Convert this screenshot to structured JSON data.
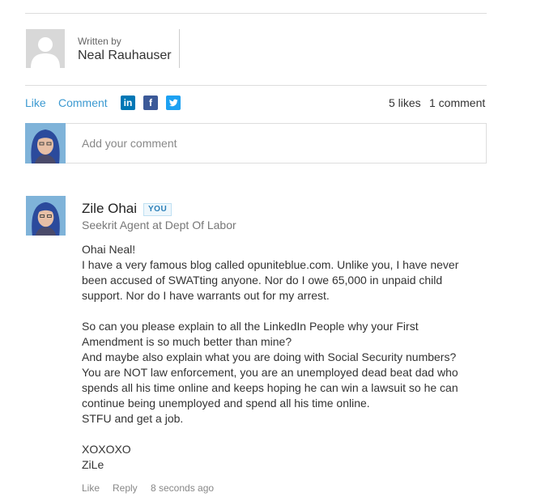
{
  "article": {
    "written_by_label": "Written by",
    "author_name": "Neal Rauhauser"
  },
  "actions": {
    "like_label": "Like",
    "comment_label": "Comment",
    "share": [
      {
        "name": "linkedin-share-icon",
        "glyph": "in",
        "color": "#0077b5"
      },
      {
        "name": "facebook-share-icon",
        "glyph": "f",
        "color": "#3b5998"
      },
      {
        "name": "twitter-share-icon",
        "glyph": "twitter",
        "color": "#1da1f2"
      }
    ],
    "likes_count": "5 likes",
    "comments_count": "1 comment"
  },
  "add_comment": {
    "placeholder": "Add your comment"
  },
  "comment": {
    "author_name": "Zile Ohai",
    "badge": "YOU",
    "author_title": "Seekrit Agent at Dept Of Labor",
    "body_lines": [
      "Ohai Neal!",
      "I have a very famous blog called opuniteblue.com. Unlike you, I have never",
      "been accused of SWATting anyone. Nor do I owe 65,000 in unpaid child",
      "support. Nor do I have warrants out for my arrest.",
      "",
      "So can you please explain to all the LinkedIn People why your First",
      "Amendment is so much better than mine?",
      "And maybe also explain what you are doing with Social Security numbers?",
      "You are NOT law enforcement, you are an unemployed dead beat dad who",
      "spends all his time online and keeps hoping he can win a lawsuit so he can",
      "continue being unemployed and spend all his time online.",
      "STFU and get a job.",
      "",
      "XOXOXO",
      "ZiLe"
    ],
    "like_label": "Like",
    "reply_label": "Reply",
    "timestamp": "8 seconds ago"
  },
  "colors": {
    "link": "#3d9ad1",
    "avatar_bg": "#7fb3d9",
    "avatar_hair": "#2b4a9c"
  }
}
